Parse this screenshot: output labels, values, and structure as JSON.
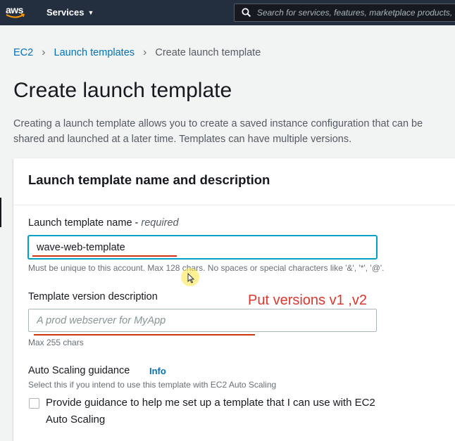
{
  "topnav": {
    "logo_text": "aws",
    "services_label": "Services",
    "search_placeholder": "Search for services, features, marketplace products, and docs"
  },
  "breadcrumb": {
    "items": [
      "EC2",
      "Launch templates"
    ],
    "current": "Create launch template"
  },
  "page": {
    "title": "Create launch template",
    "description_line1": "Creating a launch template allows you to create a saved instance configuration that can be",
    "description_line2": "shared and launched at a later time. Templates can have multiple versions."
  },
  "panel": {
    "title": "Launch template name and description",
    "name_field": {
      "label": "Launch template name - ",
      "label_required": "required",
      "value": "wave-web-template",
      "hint": "Must be unique to this account. Max 128 chars. No spaces or special characters like '&', '*', '@'."
    },
    "version_field": {
      "label": "Template version description",
      "placeholder": "A prod webserver for MyApp",
      "hint": "Max 255 chars"
    },
    "asg": {
      "label": "Auto Scaling guidance",
      "info_label": "Info",
      "hint": "Select this if you intend to use this template with EC2 Auto Scaling",
      "checkbox_label": "Provide guidance to help me set up a template that I can use with EC2 Auto Scaling",
      "checked": false
    }
  },
  "annotation": {
    "text": "Put versions v1 ,v2",
    "color": "#e0352b"
  },
  "colors": {
    "nav_bg": "#232f3e",
    "link": "#0073bb",
    "focus": "#00a1c9"
  }
}
